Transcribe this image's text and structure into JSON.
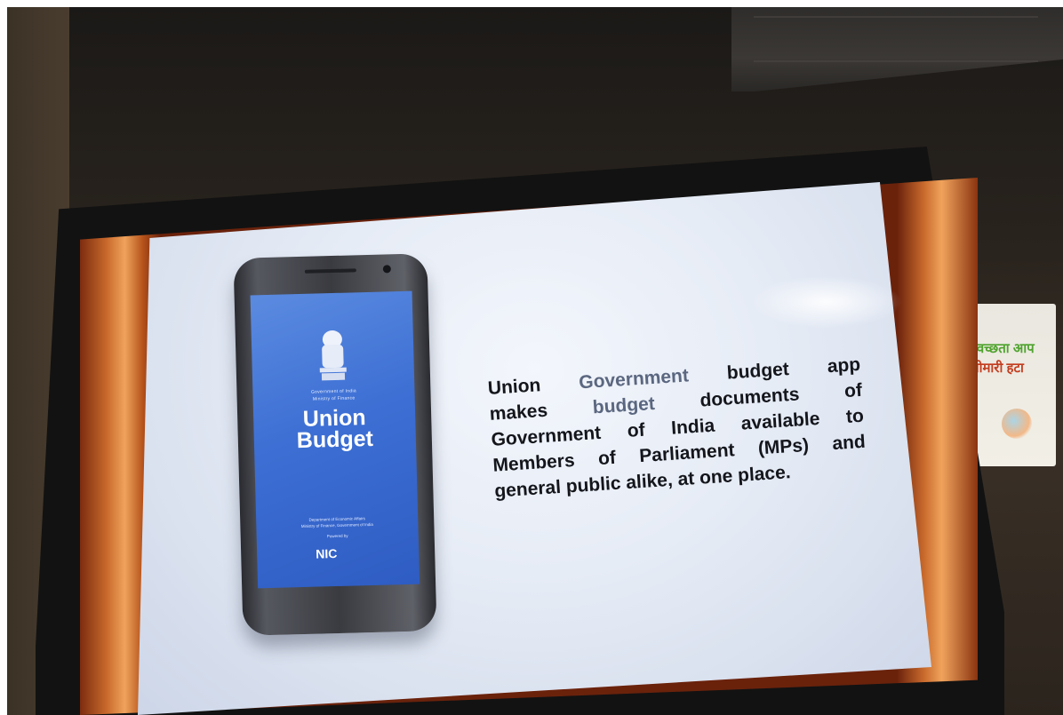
{
  "poster": {
    "line1": "स्वच्छता आप",
    "line2": "बीमारी हटा"
  },
  "phone_app": {
    "gov_line1": "Government of India",
    "gov_line2": "Ministry of Finance",
    "title_line1": "Union",
    "title_line2": "Budget",
    "dept_line1": "Department of Economic Affairs",
    "dept_line2": "Ministry of Finance, Government of India",
    "dept_line3": "Powered by",
    "nic_label": "NIC"
  },
  "slide_text": {
    "line1": [
      "Union",
      "Government",
      "budget",
      "app"
    ],
    "line2": [
      "makes",
      "budget",
      "documents",
      "of"
    ],
    "line3": [
      "Government",
      "of",
      "India",
      "available",
      "to"
    ],
    "line4": [
      "Members",
      "of",
      "Parliament",
      "(MPs)",
      "and"
    ],
    "line5": "general public alike, at one place."
  }
}
